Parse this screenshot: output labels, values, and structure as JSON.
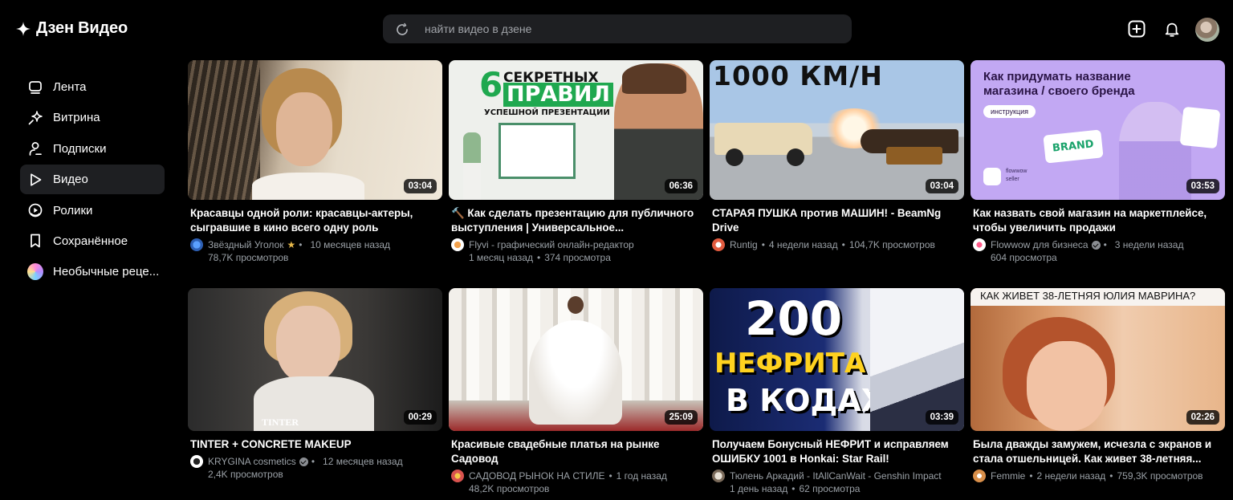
{
  "header": {
    "logo_text": "Дзен Видео",
    "search_placeholder": "найти видео в дзене"
  },
  "sidebar": {
    "items": [
      {
        "label": "Лента",
        "icon": "tv-icon"
      },
      {
        "label": "Витрина",
        "icon": "sparkle-icon"
      },
      {
        "label": "Подписки",
        "icon": "person-icon"
      },
      {
        "label": "Видео",
        "icon": "play-icon",
        "active": true
      },
      {
        "label": "Ролики",
        "icon": "shorts-icon"
      },
      {
        "label": "Сохранённое",
        "icon": "bookmark-icon"
      },
      {
        "label": "Необычные реце...",
        "icon": "channel-avatar"
      }
    ]
  },
  "videos": [
    {
      "title": "Красавцы одной роли: красавцы-актеры, сыгравшие в кино всего одну роль",
      "channel": "Звёздный Уголок",
      "ago": "10 месяцев назад",
      "views": "78,7K просмотров",
      "duration": "03:04"
    },
    {
      "title": "🔨 Как сделать презентацию для публичного выступления | Универсальное...",
      "channel": "Flyvi - графический онлайн-редактор",
      "ago": "1 месяц назад",
      "views": "374 просмотра",
      "duration": "06:36",
      "overlay": {
        "l1": "6",
        "l2": "СЕКРЕТНЫХ",
        "l3": "ПРАВИЛ",
        "l4": "УСПЕШНОЙ ПРЕЗЕНТАЦИИ"
      }
    },
    {
      "title": "СТАРАЯ ПУШКА против МАШИН! - BeamNg Drive",
      "channel": "Runtig",
      "ago": "4 недели назад",
      "views": "104,7K просмотров",
      "duration": "03:04",
      "overlay": {
        "l1": "1000 КМ/Н"
      }
    },
    {
      "title": "Как назвать свой магазин на маркетплейсе, чтобы увеличить продажи",
      "channel": "Flowwow для бизнеса",
      "ago": "3 недели назад",
      "views": "604 просмотра",
      "duration": "03:53",
      "overlay": {
        "l1": "Как придумать название",
        "l2": "магазина / своего бренда",
        "l3": "инструкция",
        "l4": "BRAND",
        "l5": "flowwow",
        "l6": "seller"
      }
    },
    {
      "title": "TINTER + CONCRETE MAKEUP",
      "channel": "KRYGINA cosmetics",
      "ago": "12 месяцев назад",
      "views": "2,4K просмотров",
      "duration": "00:29",
      "overlay": {
        "l1": "TINTER"
      }
    },
    {
      "title": "Красивые свадебные платья на рынке Садовод",
      "channel": "САДОВОД РЫНОК НА СТИЛЕ",
      "ago": "1 год назад",
      "views": "48,2K просмотров",
      "duration": "25:09"
    },
    {
      "title": "Получаем Бонусный НЕФРИТ и исправляем ОШИБКУ 1001 в Honkai: Star Rail!",
      "channel": "Тюлень Аркадий - ItAllCanWait - Genshin Impact",
      "ago": "1 день назад",
      "views": "62 просмотра",
      "duration": "03:39",
      "overlay": {
        "l1": "200",
        "l2": "НЕФРИТА",
        "l3": "В КОДАХ"
      }
    },
    {
      "title": "Была дважды замужем, исчезла с экранов и стала отшельницей. Как живет 38-летняя...",
      "channel": "Femmie",
      "ago": "2 недели назад",
      "views": "759,3K просмотров",
      "duration": "02:26",
      "overlay": {
        "l1": "КАК ЖИВЕТ 38-ЛЕТНЯЯ ЮЛИЯ МАВРИНА?"
      }
    }
  ]
}
